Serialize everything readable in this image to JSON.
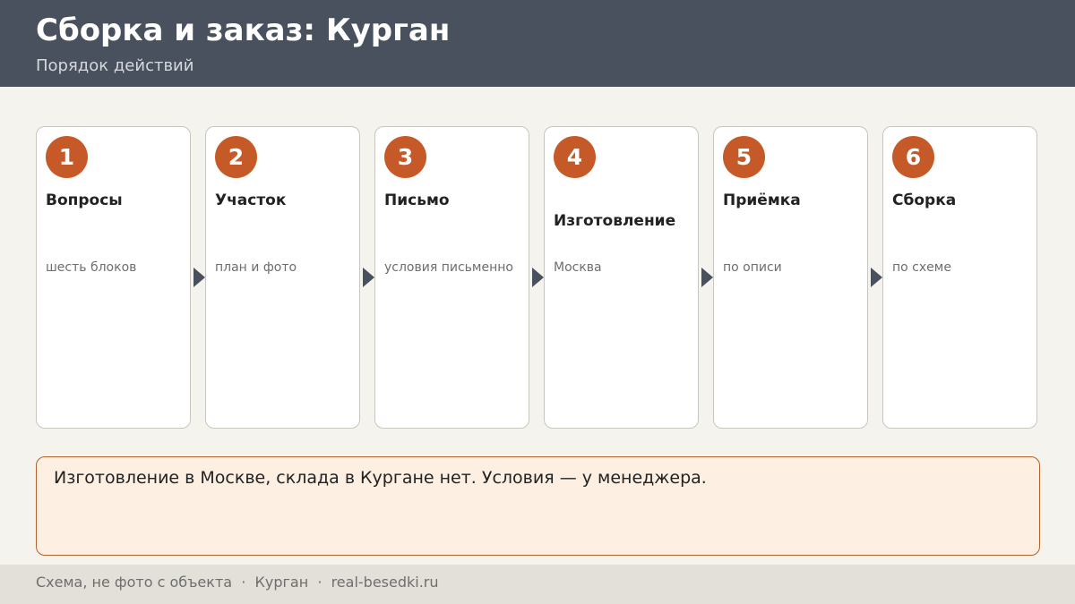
{
  "header": {
    "title": "Сборка и заказ: Курган",
    "subtitle": "Порядок действий"
  },
  "steps": [
    {
      "number": "1",
      "title": "Вопросы",
      "description": "шесть блоков"
    },
    {
      "number": "2",
      "title": "Участок",
      "description": "план и фото"
    },
    {
      "number": "3",
      "title": "Письмо",
      "description": "условия письменно"
    },
    {
      "number": "4",
      "title": "Изготовление",
      "description": "Москва"
    },
    {
      "number": "5",
      "title": "Приёмка",
      "description": "по описи"
    },
    {
      "number": "6",
      "title": "Сборка",
      "description": "по схеме"
    }
  ],
  "note": {
    "text": "Изготовление в Москве, склада в Кургане нет. Условия — у менеджера."
  },
  "footer": {
    "text": "Схема, не фото с объекта  ·  Курган  ·  real-besedki.ru"
  },
  "colors": {
    "header_bg": "#48515d",
    "accent": "#c55a28",
    "note_bg": "#fdefe1",
    "page_bg": "#f4f3ee",
    "footer_bg": "#e3e0d9"
  },
  "icons": {
    "connector": "arrow-right-icon"
  }
}
